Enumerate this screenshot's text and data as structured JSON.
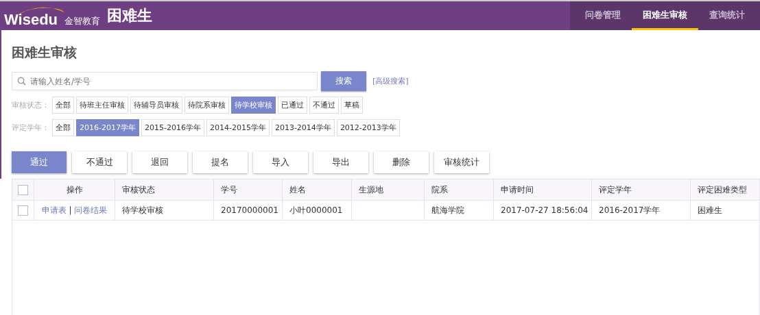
{
  "header": {
    "logo_text": "Wisedu",
    "brand_cn": "金智教育",
    "app_title": "困难生"
  },
  "nav": [
    {
      "label": "问卷管理",
      "selected": false
    },
    {
      "label": "困难生审核",
      "selected": true
    },
    {
      "label": "查询统计",
      "selected": false
    }
  ],
  "page_title": "困难生审核",
  "search": {
    "placeholder": "请输入姓名/学号",
    "button": "搜索",
    "advanced_link": "[高级搜索]"
  },
  "filters": [
    {
      "label": "审核状态：",
      "options": [
        {
          "label": "全部",
          "selected": false
        },
        {
          "label": "待班主任审核",
          "selected": false
        },
        {
          "label": "待辅导员审核",
          "selected": false
        },
        {
          "label": "待院系审核",
          "selected": false
        },
        {
          "label": "待学校审核",
          "selected": true
        },
        {
          "label": "已通过",
          "selected": false
        },
        {
          "label": "不通过",
          "selected": false
        },
        {
          "label": "草稿",
          "selected": false
        }
      ]
    },
    {
      "label": "评定学年：",
      "options": [
        {
          "label": "全部",
          "selected": false
        },
        {
          "label": "2016-2017学年",
          "selected": true
        },
        {
          "label": "2015-2016学年",
          "selected": false
        },
        {
          "label": "2014-2015学年",
          "selected": false
        },
        {
          "label": "2013-2014学年",
          "selected": false
        },
        {
          "label": "2012-2013学年",
          "selected": false
        }
      ]
    }
  ],
  "actions": [
    {
      "label": "通过",
      "kind": "primary"
    },
    {
      "label": "不通过",
      "kind": "default"
    },
    {
      "label": "退回",
      "kind": "default"
    },
    {
      "label": "提名",
      "kind": "default"
    },
    {
      "label": "导入",
      "kind": "default"
    },
    {
      "label": "导出",
      "kind": "default"
    },
    {
      "label": "删除",
      "kind": "default"
    },
    {
      "label": "审核统计",
      "kind": "default"
    }
  ],
  "table": {
    "select_all_checked": false,
    "columns": [
      "操作",
      "审核状态",
      "学号",
      "姓名",
      "生源地",
      "院系",
      "申请时间",
      "评定学年",
      "评定困难类型"
    ],
    "rows": [
      {
        "checked": false,
        "cells": [
          {
            "kind": "links",
            "links": [
              "申请表",
              "问卷结果"
            ],
            "separator": "|"
          },
          {
            "kind": "text",
            "text": "待学校审核"
          },
          {
            "kind": "text",
            "text": "20170000001"
          },
          {
            "kind": "text",
            "text": "小叶0000001"
          },
          {
            "kind": "text",
            "text": ""
          },
          {
            "kind": "text",
            "text": "航海学院"
          },
          {
            "kind": "text",
            "text": "2017-07-27 18:56:04"
          },
          {
            "kind": "text",
            "text": "2016-2017学年"
          },
          {
            "kind": "text",
            "text": "困难生"
          }
        ]
      }
    ]
  }
}
